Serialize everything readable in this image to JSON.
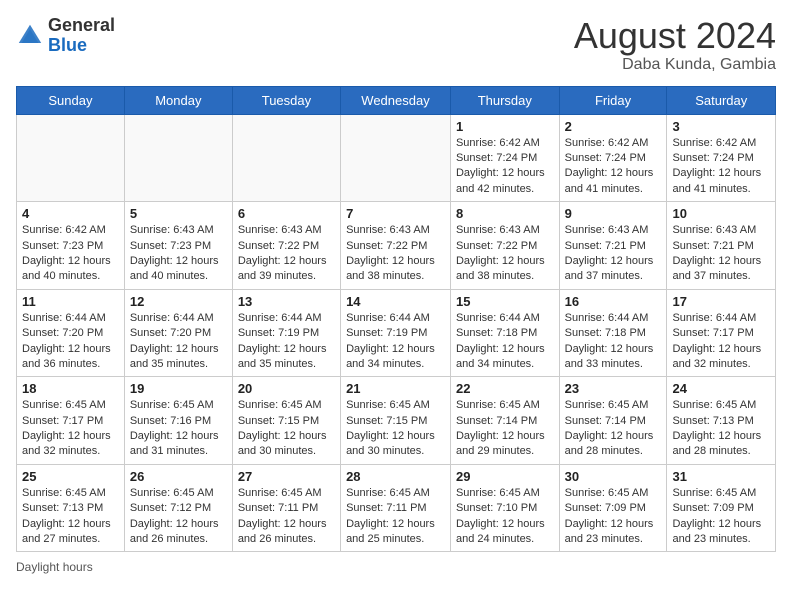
{
  "logo": {
    "general": "General",
    "blue": "Blue"
  },
  "title": {
    "month_year": "August 2024",
    "location": "Daba Kunda, Gambia"
  },
  "days_of_week": [
    "Sunday",
    "Monday",
    "Tuesday",
    "Wednesday",
    "Thursday",
    "Friday",
    "Saturday"
  ],
  "weeks": [
    [
      {
        "day": "",
        "info": ""
      },
      {
        "day": "",
        "info": ""
      },
      {
        "day": "",
        "info": ""
      },
      {
        "day": "",
        "info": ""
      },
      {
        "day": "1",
        "info": "Sunrise: 6:42 AM\nSunset: 7:24 PM\nDaylight: 12 hours and 42 minutes."
      },
      {
        "day": "2",
        "info": "Sunrise: 6:42 AM\nSunset: 7:24 PM\nDaylight: 12 hours and 41 minutes."
      },
      {
        "day": "3",
        "info": "Sunrise: 6:42 AM\nSunset: 7:24 PM\nDaylight: 12 hours and 41 minutes."
      }
    ],
    [
      {
        "day": "4",
        "info": "Sunrise: 6:42 AM\nSunset: 7:23 PM\nDaylight: 12 hours and 40 minutes."
      },
      {
        "day": "5",
        "info": "Sunrise: 6:43 AM\nSunset: 7:23 PM\nDaylight: 12 hours and 40 minutes."
      },
      {
        "day": "6",
        "info": "Sunrise: 6:43 AM\nSunset: 7:22 PM\nDaylight: 12 hours and 39 minutes."
      },
      {
        "day": "7",
        "info": "Sunrise: 6:43 AM\nSunset: 7:22 PM\nDaylight: 12 hours and 38 minutes."
      },
      {
        "day": "8",
        "info": "Sunrise: 6:43 AM\nSunset: 7:22 PM\nDaylight: 12 hours and 38 minutes."
      },
      {
        "day": "9",
        "info": "Sunrise: 6:43 AM\nSunset: 7:21 PM\nDaylight: 12 hours and 37 minutes."
      },
      {
        "day": "10",
        "info": "Sunrise: 6:43 AM\nSunset: 7:21 PM\nDaylight: 12 hours and 37 minutes."
      }
    ],
    [
      {
        "day": "11",
        "info": "Sunrise: 6:44 AM\nSunset: 7:20 PM\nDaylight: 12 hours and 36 minutes."
      },
      {
        "day": "12",
        "info": "Sunrise: 6:44 AM\nSunset: 7:20 PM\nDaylight: 12 hours and 35 minutes."
      },
      {
        "day": "13",
        "info": "Sunrise: 6:44 AM\nSunset: 7:19 PM\nDaylight: 12 hours and 35 minutes."
      },
      {
        "day": "14",
        "info": "Sunrise: 6:44 AM\nSunset: 7:19 PM\nDaylight: 12 hours and 34 minutes."
      },
      {
        "day": "15",
        "info": "Sunrise: 6:44 AM\nSunset: 7:18 PM\nDaylight: 12 hours and 34 minutes."
      },
      {
        "day": "16",
        "info": "Sunrise: 6:44 AM\nSunset: 7:18 PM\nDaylight: 12 hours and 33 minutes."
      },
      {
        "day": "17",
        "info": "Sunrise: 6:44 AM\nSunset: 7:17 PM\nDaylight: 12 hours and 32 minutes."
      }
    ],
    [
      {
        "day": "18",
        "info": "Sunrise: 6:45 AM\nSunset: 7:17 PM\nDaylight: 12 hours and 32 minutes."
      },
      {
        "day": "19",
        "info": "Sunrise: 6:45 AM\nSunset: 7:16 PM\nDaylight: 12 hours and 31 minutes."
      },
      {
        "day": "20",
        "info": "Sunrise: 6:45 AM\nSunset: 7:15 PM\nDaylight: 12 hours and 30 minutes."
      },
      {
        "day": "21",
        "info": "Sunrise: 6:45 AM\nSunset: 7:15 PM\nDaylight: 12 hours and 30 minutes."
      },
      {
        "day": "22",
        "info": "Sunrise: 6:45 AM\nSunset: 7:14 PM\nDaylight: 12 hours and 29 minutes."
      },
      {
        "day": "23",
        "info": "Sunrise: 6:45 AM\nSunset: 7:14 PM\nDaylight: 12 hours and 28 minutes."
      },
      {
        "day": "24",
        "info": "Sunrise: 6:45 AM\nSunset: 7:13 PM\nDaylight: 12 hours and 28 minutes."
      }
    ],
    [
      {
        "day": "25",
        "info": "Sunrise: 6:45 AM\nSunset: 7:13 PM\nDaylight: 12 hours and 27 minutes."
      },
      {
        "day": "26",
        "info": "Sunrise: 6:45 AM\nSunset: 7:12 PM\nDaylight: 12 hours and 26 minutes."
      },
      {
        "day": "27",
        "info": "Sunrise: 6:45 AM\nSunset: 7:11 PM\nDaylight: 12 hours and 26 minutes."
      },
      {
        "day": "28",
        "info": "Sunrise: 6:45 AM\nSunset: 7:11 PM\nDaylight: 12 hours and 25 minutes."
      },
      {
        "day": "29",
        "info": "Sunrise: 6:45 AM\nSunset: 7:10 PM\nDaylight: 12 hours and 24 minutes."
      },
      {
        "day": "30",
        "info": "Sunrise: 6:45 AM\nSunset: 7:09 PM\nDaylight: 12 hours and 23 minutes."
      },
      {
        "day": "31",
        "info": "Sunrise: 6:45 AM\nSunset: 7:09 PM\nDaylight: 12 hours and 23 minutes."
      }
    ]
  ],
  "footer": {
    "note": "Daylight hours"
  }
}
